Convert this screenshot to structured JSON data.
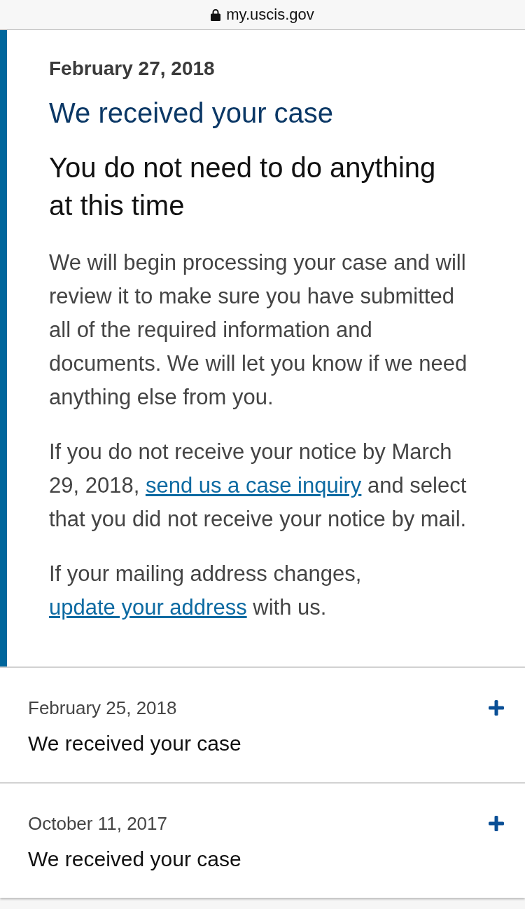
{
  "browser": {
    "address": "my.uscis.gov"
  },
  "current_status": {
    "date": "February 27, 2018",
    "title": "We received your case",
    "subtitle": "You do not need to do anything at this time",
    "paragraphs": [
      [
        {
          "kind": "text",
          "text": "We will begin processing your case and will review it to make sure you have submitted all of the required information and documents. We will let you know if we need anything else from you."
        }
      ],
      [
        {
          "kind": "text",
          "text": "If you do not receive your notice by March 29, 2018, "
        },
        {
          "kind": "link",
          "text": "send us a case inquiry"
        },
        {
          "kind": "text",
          "text": " and select that you did not receive your notice by mail."
        }
      ],
      [
        {
          "kind": "text",
          "text": "If your mailing address changes, "
        },
        {
          "kind": "link",
          "text": "update your address"
        },
        {
          "kind": "text",
          "text": " with us."
        }
      ]
    ]
  },
  "history": [
    {
      "date": "February 25, 2018",
      "title": "We received your case",
      "expanded": false
    },
    {
      "date": "October 11, 2017",
      "title": "We received your case",
      "expanded": false
    }
  ]
}
